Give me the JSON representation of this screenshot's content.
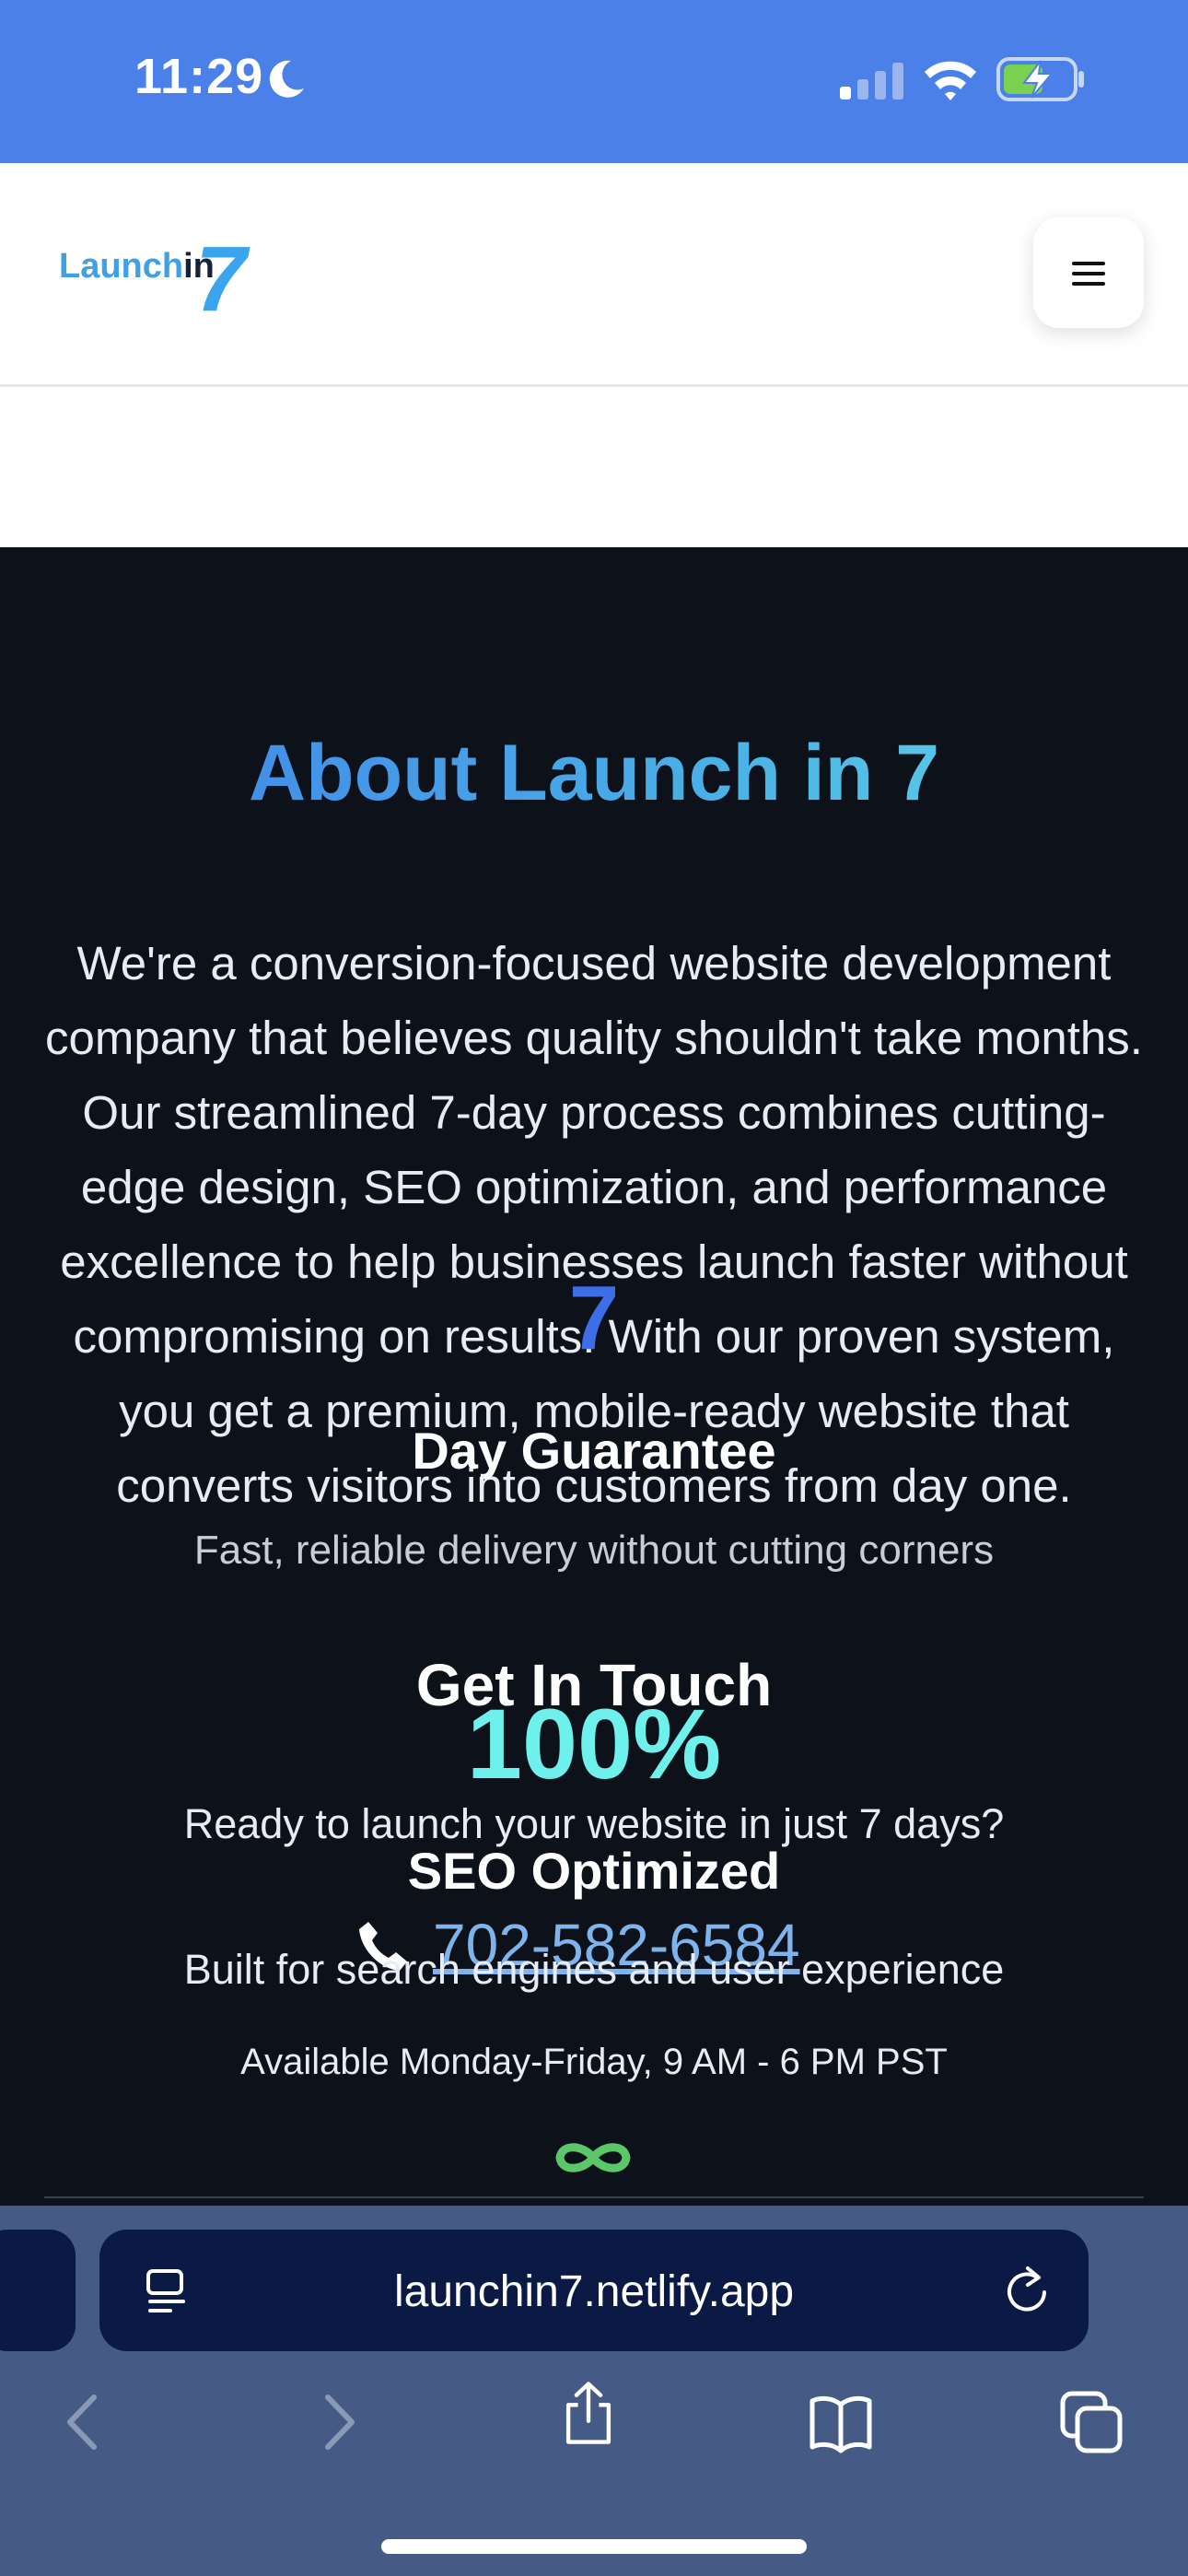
{
  "status_bar": {
    "time": "11:29",
    "icons": [
      "moon-icon",
      "signal-icon",
      "wifi-icon",
      "battery-charging-icon"
    ]
  },
  "header": {
    "logo_text_main": "Launch",
    "logo_text_in": "in",
    "logo_seven": "7"
  },
  "about": {
    "title": "About Launch in 7",
    "body": "We're a conversion-focused website development company that believes quality shouldn't take months. Our streamlined 7-day process combines cutting-edge design, SEO optimization, and performance excellence to help businesses launch faster without compromising on results. With our proven system, you get a premium, mobile-ready website that converts visitors into customers from day one."
  },
  "stats": [
    {
      "number": "7",
      "label": "Day Guarantee",
      "description": "Fast, reliable delivery without cutting corners"
    },
    {
      "number": "100%",
      "label": "SEO Optimized",
      "description": "Built for search engines and user experience"
    }
  ],
  "contact": {
    "title": "Get In Touch",
    "description": "Ready to launch your website in just 7 days?",
    "phone": "702-582-6584",
    "hours": "Available Monday-Friday, 9 AM - 6 PM PST"
  },
  "browser": {
    "url": "launchin7.netlify.app"
  },
  "colors": {
    "status_bar_bg": "#4a80e8",
    "section_bg": "#0d111a",
    "title_gradient_start": "#3f7fe8",
    "title_gradient_end": "#64dbe6",
    "stat1_color": "#3d6ee8",
    "stat2_color": "#6ef0ec",
    "link_color": "#7fb3ec",
    "infinity_color": "#5cc768",
    "browser_bar_bg": "#455a85",
    "address_bar_bg": "#0b1a44"
  }
}
